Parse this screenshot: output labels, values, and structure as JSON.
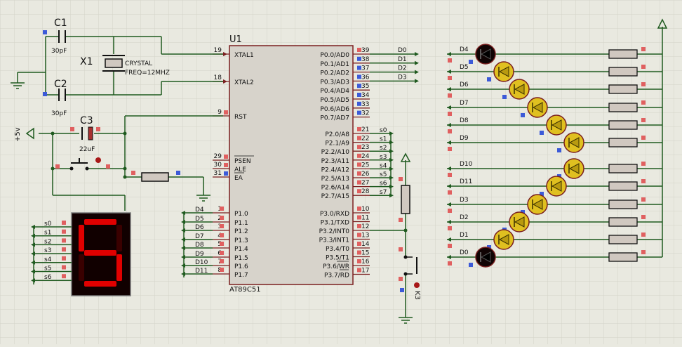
{
  "colors": {
    "background": "#e9e9e0",
    "grid": "#d4d4c8",
    "wire": "#1f5a1f",
    "chip_fill": "#d7d3cb",
    "chip_stroke": "#7a1f1f",
    "pin_stub": "#7a1f1f",
    "text": "#111111",
    "pin_num": "#111111",
    "pin_marker_red": "#e06060",
    "pin_marker_blue": "#3c5ad8",
    "led_on_fill": "#b89a10",
    "led_on_body": "#e0c020",
    "led_off_fill": "#100404",
    "seg_bg": "#110000",
    "seg_on": "#e00000",
    "seg_off": "#3a0000",
    "resistor_fill": "#d0c8c0"
  },
  "mcu": {
    "ref": "U1",
    "part": "AT89C51",
    "left_pins": [
      {
        "num": "19",
        "name": "XTAL1"
      },
      {
        "num": "18",
        "name": "XTAL2"
      },
      {
        "num": "9",
        "name": "RST"
      },
      {
        "num": "29",
        "name": "PSEN"
      },
      {
        "num": "30",
        "name": "ALE"
      },
      {
        "num": "31",
        "name": "EA"
      },
      {
        "num": "1",
        "name": "P1.0"
      },
      {
        "num": "2",
        "name": "P1.1"
      },
      {
        "num": "3",
        "name": "P1.2"
      },
      {
        "num": "4",
        "name": "P1.3"
      },
      {
        "num": "5",
        "name": "P1.4"
      },
      {
        "num": "6",
        "name": "P1.5"
      },
      {
        "num": "7",
        "name": "P1.6"
      },
      {
        "num": "8",
        "name": "P1.7"
      }
    ],
    "right_pins": [
      {
        "num": "39",
        "name": "P0.0/AD0"
      },
      {
        "num": "38",
        "name": "P0.1/AD1"
      },
      {
        "num": "37",
        "name": "P0.2/AD2"
      },
      {
        "num": "36",
        "name": "P0.3/AD3"
      },
      {
        "num": "35",
        "name": "P0.4/AD4"
      },
      {
        "num": "34",
        "name": "P0.5/AD5"
      },
      {
        "num": "33",
        "name": "P0.6/AD6"
      },
      {
        "num": "32",
        "name": "P0.7/AD7"
      },
      {
        "num": "21",
        "name": "P2.0/A8"
      },
      {
        "num": "22",
        "name": "P2.1/A9"
      },
      {
        "num": "23",
        "name": "P2.2/A10"
      },
      {
        "num": "24",
        "name": "P2.3/A11"
      },
      {
        "num": "25",
        "name": "P2.4/A12"
      },
      {
        "num": "26",
        "name": "P2.5/A13"
      },
      {
        "num": "27",
        "name": "P2.6/A14"
      },
      {
        "num": "28",
        "name": "P2.7/A15"
      },
      {
        "num": "10",
        "name": "P3.0/RXD"
      },
      {
        "num": "11",
        "name": "P3.1/TXD"
      },
      {
        "num": "12",
        "name": "P3.2/INT0"
      },
      {
        "num": "13",
        "name": "P3.3/INT1"
      },
      {
        "num": "14",
        "name": "P3.4/T0"
      },
      {
        "num": "15",
        "name": "P3.5/T1"
      },
      {
        "num": "16",
        "name": "P3.6/WR"
      },
      {
        "num": "17",
        "name": "P3.7/RD"
      }
    ]
  },
  "p0_nets": [
    "D0",
    "D1",
    "D2",
    "D3"
  ],
  "p2_nets": [
    "s0",
    "s1",
    "s2",
    "s3",
    "s4",
    "s5",
    "s6",
    "s7"
  ],
  "p1_nets": [
    "D4",
    "D5",
    "D6",
    "D7",
    "D8",
    "D9",
    "D10",
    "D11"
  ],
  "c1": {
    "ref": "C1",
    "value": "30pF"
  },
  "c2": {
    "ref": "C2",
    "value": "30pF"
  },
  "c3": {
    "ref": "C3",
    "value": "22uF"
  },
  "x1": {
    "ref": "X1",
    "line1": "CRYSTAL",
    "line2": "FREQ=12MHZ"
  },
  "power": {
    "label": "+5v"
  },
  "seg_display": {
    "digit": "5",
    "segments_lit": [
      "a",
      "f",
      "g",
      "c",
      "d"
    ],
    "nets": [
      "s0",
      "s1",
      "s2",
      "s3",
      "s4",
      "s5",
      "s6"
    ]
  },
  "leds": [
    {
      "net": "D4",
      "on": false
    },
    {
      "net": "D5",
      "on": true
    },
    {
      "net": "D6",
      "on": true
    },
    {
      "net": "D7",
      "on": true
    },
    {
      "net": "D8",
      "on": true
    },
    {
      "net": "D9",
      "on": true
    },
    {
      "net": "D10",
      "on": true
    },
    {
      "net": "D11",
      "on": true
    },
    {
      "net": "D3",
      "on": true
    },
    {
      "net": "D2",
      "on": true
    },
    {
      "net": "D1",
      "on": true
    },
    {
      "net": "D0",
      "on": false
    }
  ],
  "k3": {
    "ref": "K3"
  }
}
